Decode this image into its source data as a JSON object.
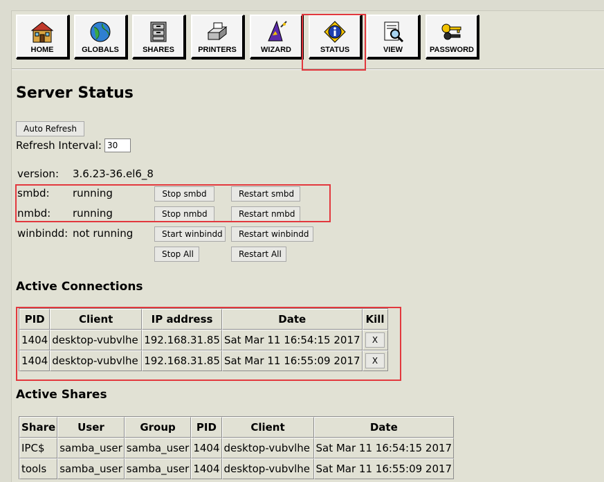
{
  "nav": [
    {
      "label": "HOME",
      "icon": "house-icon"
    },
    {
      "label": "GLOBALS",
      "icon": "globe-icon"
    },
    {
      "label": "SHARES",
      "icon": "file-cabinet-icon"
    },
    {
      "label": "PRINTERS",
      "icon": "printer-icon"
    },
    {
      "label": "WIZARD",
      "icon": "wizard-hat-icon"
    },
    {
      "label": "STATUS",
      "icon": "info-icon"
    },
    {
      "label": "VIEW",
      "icon": "document-magnifier-icon"
    },
    {
      "label": "PASSWORD",
      "icon": "keys-icon"
    }
  ],
  "page_title": "Server Status",
  "auto_refresh_label": "Auto Refresh",
  "refresh_interval_label": "Refresh Interval:",
  "refresh_interval_value": "30",
  "version": {
    "label": "version:",
    "value": "3.6.23-36.el6_8"
  },
  "services": [
    {
      "name": "smbd:",
      "status": "running",
      "stop": "Stop smbd",
      "restart": "Restart smbd"
    },
    {
      "name": "nmbd:",
      "status": "running",
      "stop": "Stop nmbd",
      "restart": "Restart nmbd"
    },
    {
      "name": "winbindd:",
      "status": "not running",
      "start": "Start winbindd",
      "restart": "Restart winbindd"
    }
  ],
  "stop_all": "Stop All",
  "restart_all": "Restart All",
  "active_connections": {
    "title": "Active Connections",
    "headers": [
      "PID",
      "Client",
      "IP address",
      "Date",
      "Kill"
    ],
    "rows": [
      {
        "pid": "1404",
        "client": "desktop-vubvlhe",
        "ip": "192.168.31.85",
        "date": "Sat Mar 11 16:54:15 2017",
        "kill": "X"
      },
      {
        "pid": "1404",
        "client": "desktop-vubvlhe",
        "ip": "192.168.31.85",
        "date": "Sat Mar 11 16:55:09 2017",
        "kill": "X"
      }
    ]
  },
  "active_shares": {
    "title": "Active Shares",
    "headers": [
      "Share",
      "User",
      "Group",
      "PID",
      "Client",
      "Date"
    ],
    "rows": [
      {
        "share": "IPC$",
        "user": "samba_user",
        "group": "samba_user",
        "pid": "1404",
        "client": "desktop-vubvlhe",
        "date": "Sat Mar 11 16:54:15 2017"
      },
      {
        "share": "tools",
        "user": "samba_user",
        "group": "samba_user",
        "pid": "1404",
        "client": "desktop-vubvlhe",
        "date": "Sat Mar 11 16:55:09 2017"
      }
    ]
  },
  "highlight_color": "#e2373d"
}
